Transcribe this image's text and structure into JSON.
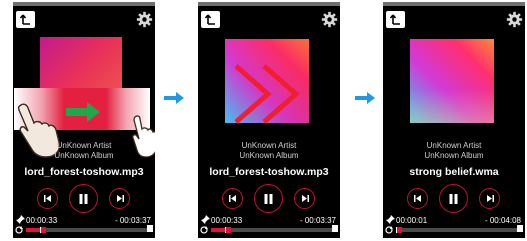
{
  "screens": [
    {
      "artist": "UnKnown Artist",
      "album": "UnKnown Album",
      "track": "lord_forest-toshow.mp3",
      "elapsed": "00:00:33",
      "remaining": "- 00:03:37",
      "progress": 0.13
    },
    {
      "artist": "UnKnown Artist",
      "album": "UnKnown Album",
      "track": "lord_forest-toshow.mp3",
      "elapsed": "00:00:33",
      "remaining": "- 00:03:37",
      "progress": 0.13
    },
    {
      "artist": "UnKnown Artist",
      "album": "UnKnown Album",
      "track": "strong belief.wma",
      "elapsed": "00:00:01",
      "remaining": "- 00:04:08",
      "progress": 0.01
    }
  ],
  "icons": {
    "back": "back-icon",
    "settings": "gear-icon",
    "prev": "previous-track-icon",
    "pause": "pause-icon",
    "next": "next-track-icon",
    "flow": "right-arrow-icon",
    "gesture": "swipe-hand-icon"
  },
  "colors": {
    "accent": "#e0123a",
    "flow_arrow": "#1e9be0",
    "swipe_arrow": "#1fa84a"
  }
}
